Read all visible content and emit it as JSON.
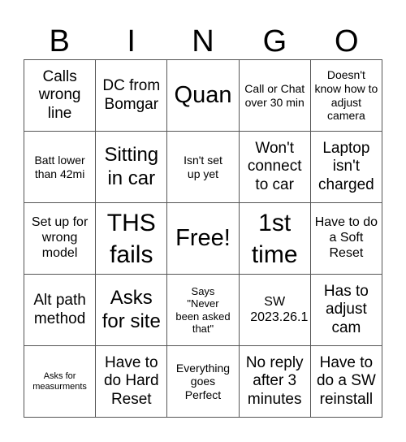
{
  "header": {
    "letters": [
      "B",
      "I",
      "N",
      "G",
      "O"
    ]
  },
  "cells": [
    [
      "Calls wrong line",
      "DC from Bomgar",
      "Quan",
      "Call or Chat over 30 min",
      "Doesn't know how to adjust camera"
    ],
    [
      "Batt lower than 42mi",
      "Sitting in car",
      "Isn't set up yet",
      "Won't connect to car",
      "Laptop isn't charged"
    ],
    [
      "Set up for wrong model",
      "THS fails",
      "Free!",
      "1st time",
      "Have to do a Soft Reset"
    ],
    [
      "Alt path method",
      "Asks for site",
      "Says \"Never been asked that\"",
      "SW 2023.26.1",
      "Has to adjust cam"
    ],
    [
      "Asks for measurments",
      "Have to do Hard Reset",
      "Everything goes Perfect",
      "No reply after 3 minutes",
      "Have to do a SW reinstall"
    ]
  ]
}
